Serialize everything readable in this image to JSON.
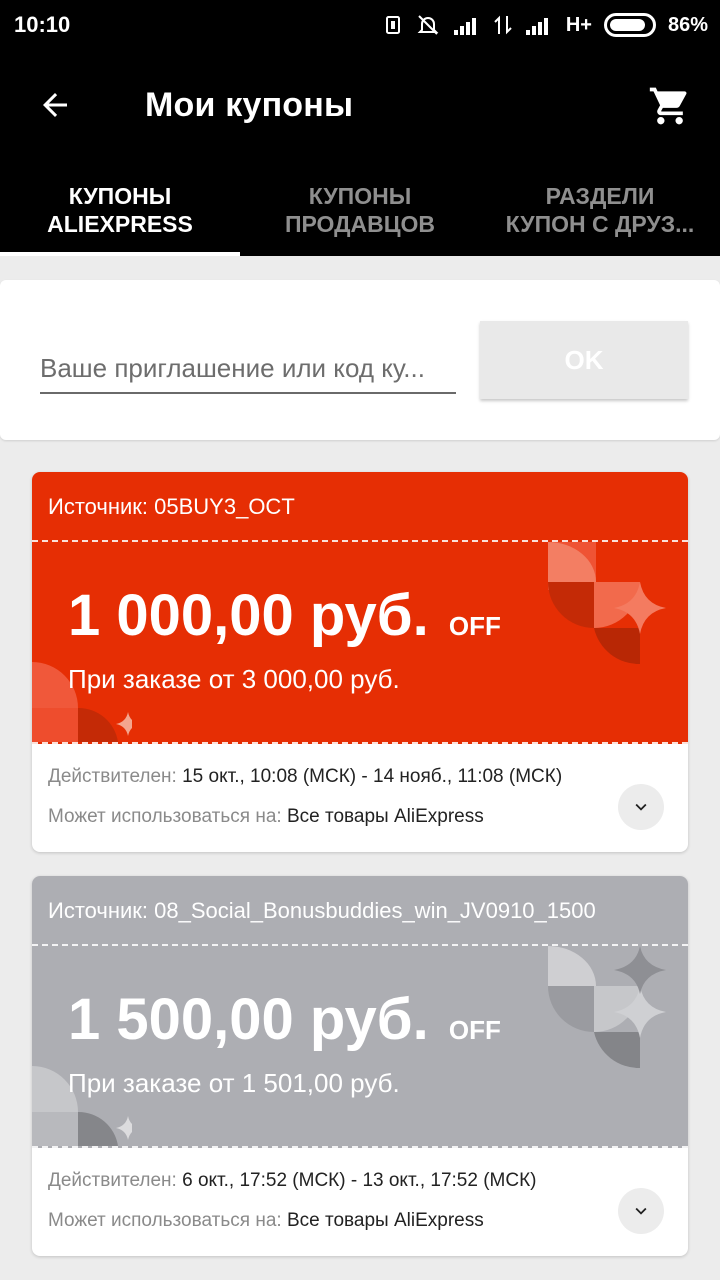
{
  "status_bar": {
    "time": "10:10",
    "network": "H+",
    "battery": "86%"
  },
  "app_bar": {
    "title": "Мои купоны",
    "back_icon": "arrow-back-icon",
    "cart_icon": "cart-icon"
  },
  "tabs": [
    {
      "line1": "КУПОНЫ",
      "line2": "ALIEXPRESS",
      "active": true
    },
    {
      "line1": "КУПОНЫ",
      "line2": "ПРОДАВЦОВ",
      "active": false
    },
    {
      "line1": "РАЗДЕЛИ",
      "line2": "КУПОН С ДРУЗ...",
      "active": false
    }
  ],
  "code_form": {
    "placeholder": "Ваше приглашение или код ку...",
    "ok_label": "OK"
  },
  "coupons": [
    {
      "source": "Источник: 05BUY3_OCT",
      "amount": "1 000,00 руб.",
      "off": "OFF",
      "min_order": "При заказе от 3 000,00 руб.",
      "valid_label": "Действителен:",
      "valid_value": "15 окт., 10:08 (МСК) - 14 нояб., 11:08 (МСК)",
      "usable_label": "Может использоваться на:",
      "usable_value": "Все товары AliExpress",
      "color": "#e62e04"
    },
    {
      "source": "Источник: 08_Social_Bonusbuddies_win_JV0910_1500",
      "amount": "1 500,00 руб.",
      "off": "OFF",
      "min_order": "При заказе от 1 501,00 руб.",
      "valid_label": "Действителен:",
      "valid_value": "6 окт., 17:52 (МСК) - 13 окт., 17:52 (МСК)",
      "usable_label": "Может использоваться на:",
      "usable_value": "Все товары AliExpress",
      "color": "#adaeb3"
    }
  ]
}
